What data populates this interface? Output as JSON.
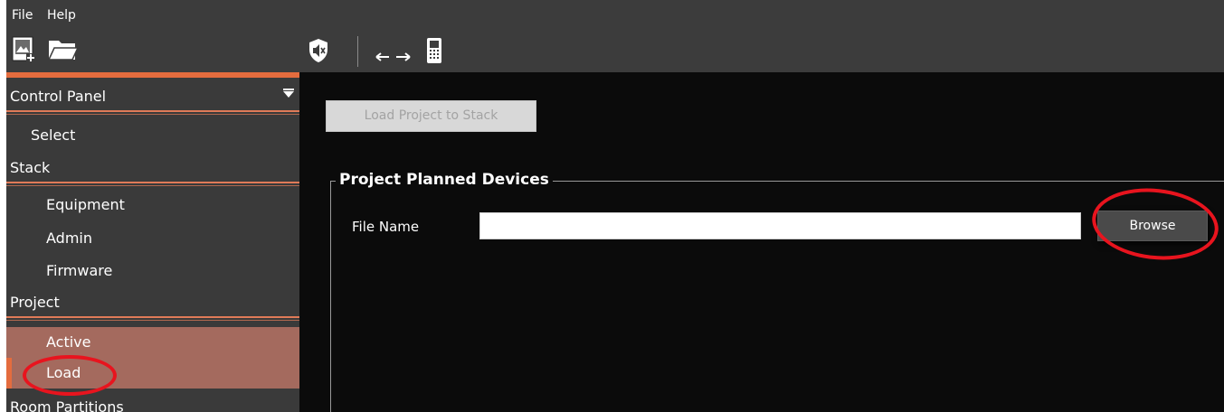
{
  "menubar": {
    "file": "File",
    "help": "Help"
  },
  "toolbar": {
    "icons": [
      "new-project-icon",
      "open-folder-icon",
      "shield-mute-icon",
      "swap-arrows-icon",
      "device-icon"
    ]
  },
  "sidebar": {
    "control_panel": "Control Panel",
    "select": "Select",
    "stack": "Stack",
    "equipment": "Equipment",
    "admin": "Admin",
    "firmware": "Firmware",
    "project": "Project",
    "active": "Active",
    "load": "Load",
    "room_partitions": "Room Partitions"
  },
  "main": {
    "load_button": "Load Project to Stack",
    "group_title": "Project Planned Devices",
    "file_label": "File Name",
    "file_value": "",
    "browse_button": "Browse"
  },
  "colors": {
    "accent": "#e46c3e",
    "selected_bg": "#a46a5e",
    "annotation": "#e8141e"
  }
}
